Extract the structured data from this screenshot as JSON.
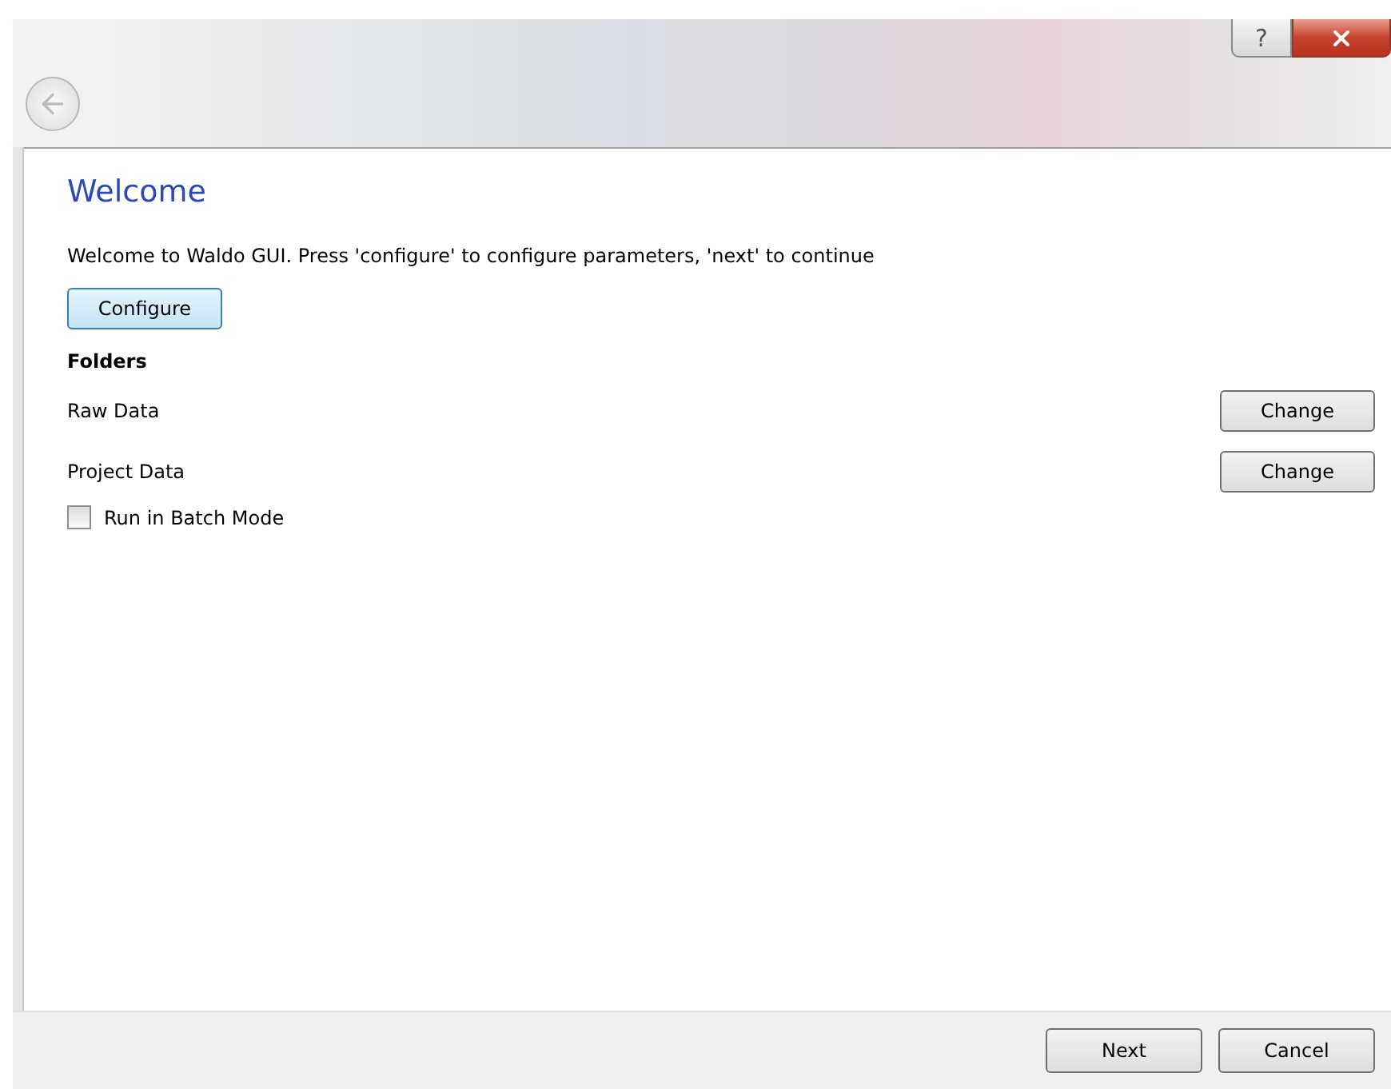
{
  "title_buttons": {
    "help": "?"
  },
  "page": {
    "title": "Welcome",
    "intro": "Welcome to Waldo GUI. Press 'configure' to configure parameters, 'next' to continue",
    "configure_button": "Configure",
    "section": "Folders",
    "folders": [
      {
        "label": "Raw Data",
        "button": "Change"
      },
      {
        "label": "Project Data",
        "button": "Change"
      }
    ],
    "batch_mode": {
      "label": "Run in Batch Mode",
      "checked": false
    }
  },
  "footer": {
    "buttons": [
      "Next",
      "Cancel"
    ]
  }
}
